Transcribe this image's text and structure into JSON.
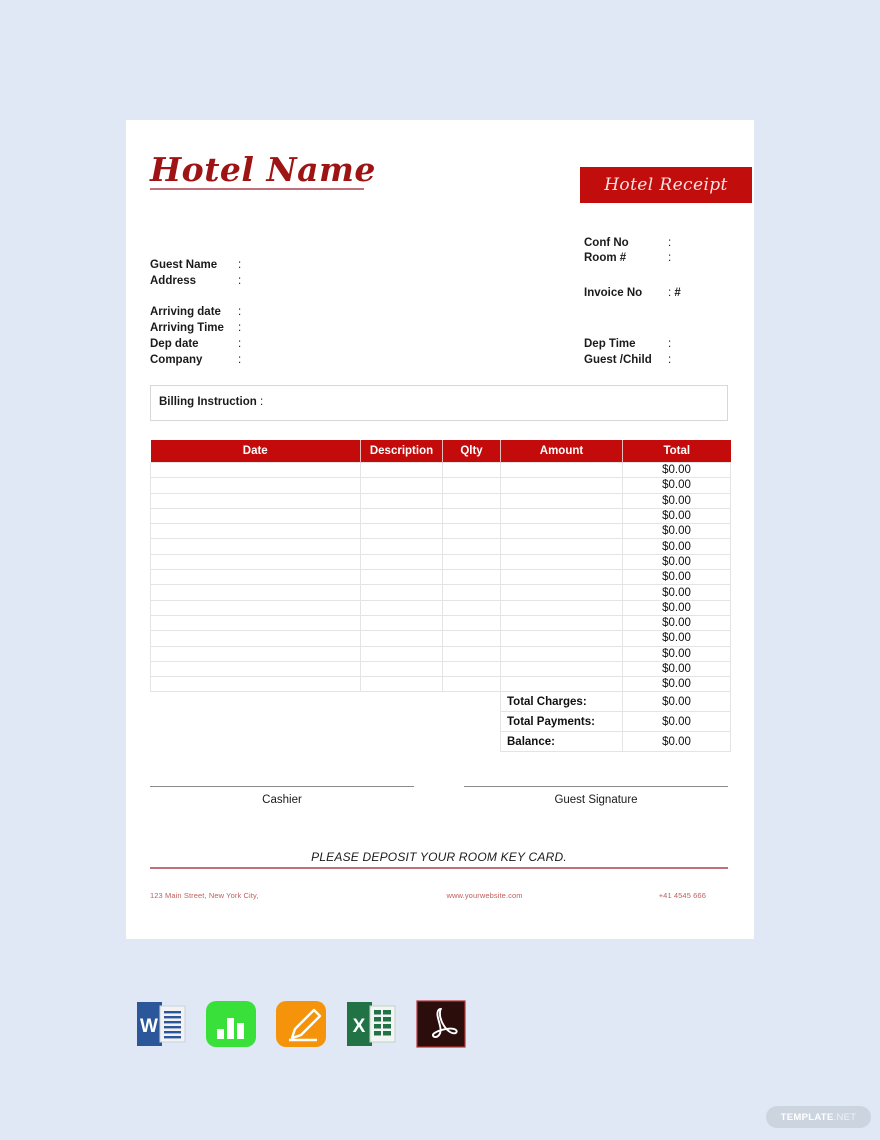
{
  "document": {
    "hotel_name": "Hotel Name",
    "receipt_badge": "Hotel Receipt"
  },
  "right_fields_top": [
    {
      "label": "Conf No",
      "colon": ":",
      "value": ""
    },
    {
      "label": "Room #",
      "colon": ":",
      "value": ""
    }
  ],
  "invoice": {
    "label": "Invoice No",
    "colon": ":",
    "value": "#"
  },
  "left_fields_guest": [
    {
      "label": "Guest Name",
      "colon": ":",
      "value": ""
    },
    {
      "label": "Address",
      "colon": ":",
      "value": ""
    }
  ],
  "left_fields_stay": [
    {
      "label": "Arriving date",
      "colon": ":",
      "value": ""
    },
    {
      "label": "Arriving Time",
      "colon": ":",
      "value": ""
    },
    {
      "label": "Dep date",
      "colon": ":",
      "value": ""
    },
    {
      "label": "Company",
      "colon": ":",
      "value": ""
    }
  ],
  "right_fields_bottom": [
    {
      "label": "Dep Time",
      "colon": ":",
      "value": ""
    },
    {
      "label": "Guest /Child",
      "colon": ":",
      "value": ""
    }
  ],
  "billing": {
    "label": "Billing Instruction",
    "colon": ":"
  },
  "table": {
    "headers": [
      "Date",
      "Description",
      "Qlty",
      "Amount",
      "Total"
    ],
    "rows": [
      {
        "date": "",
        "description": "",
        "qlty": "",
        "amount": "",
        "total": "$0.00"
      },
      {
        "date": "",
        "description": "",
        "qlty": "",
        "amount": "",
        "total": "$0.00"
      },
      {
        "date": "",
        "description": "",
        "qlty": "",
        "amount": "",
        "total": "$0.00"
      },
      {
        "date": "",
        "description": "",
        "qlty": "",
        "amount": "",
        "total": "$0.00"
      },
      {
        "date": "",
        "description": "",
        "qlty": "",
        "amount": "",
        "total": "$0.00"
      },
      {
        "date": "",
        "description": "",
        "qlty": "",
        "amount": "",
        "total": "$0.00"
      },
      {
        "date": "",
        "description": "",
        "qlty": "",
        "amount": "",
        "total": "$0.00"
      },
      {
        "date": "",
        "description": "",
        "qlty": "",
        "amount": "",
        "total": "$0.00"
      },
      {
        "date": "",
        "description": "",
        "qlty": "",
        "amount": "",
        "total": "$0.00"
      },
      {
        "date": "",
        "description": "",
        "qlty": "",
        "amount": "",
        "total": "$0.00"
      },
      {
        "date": "",
        "description": "",
        "qlty": "",
        "amount": "",
        "total": "$0.00"
      },
      {
        "date": "",
        "description": "",
        "qlty": "",
        "amount": "",
        "total": "$0.00"
      },
      {
        "date": "",
        "description": "",
        "qlty": "",
        "amount": "",
        "total": "$0.00"
      },
      {
        "date": "",
        "description": "",
        "qlty": "",
        "amount": "",
        "total": "$0.00"
      },
      {
        "date": "",
        "description": "",
        "qlty": "",
        "amount": "",
        "total": "$0.00"
      }
    ],
    "summary": [
      {
        "label": "Total Charges:",
        "value": "$0.00"
      },
      {
        "label": "Total Payments:",
        "value": "$0.00"
      },
      {
        "label": "Balance:",
        "value": "$0.00"
      }
    ]
  },
  "signatures": {
    "cashier": "Cashier",
    "guest": "Guest Signature"
  },
  "notice": "PLEASE DEPOSIT YOUR ROOM KEY CARD.",
  "contact": {
    "address": "123 Main Street, New York City,",
    "website": "www.yourwebsite.com",
    "phone": "+41 4545 666"
  },
  "file_formats": [
    {
      "name": "word-icon",
      "letter": "W"
    },
    {
      "name": "numbers-icon",
      "letter": ""
    },
    {
      "name": "pages-icon",
      "letter": ""
    },
    {
      "name": "excel-icon",
      "letter": "X"
    },
    {
      "name": "pdf-icon",
      "letter": ""
    }
  ],
  "watermark": {
    "bold": "TEMPLATE",
    "light": ".NET"
  },
  "colors": {
    "page_background": "#dfe8f4",
    "brand_red": "#c40b0b",
    "script_red": "#9e1414",
    "rule_rose": "#c0707a",
    "contact_text": "#c0605f"
  }
}
